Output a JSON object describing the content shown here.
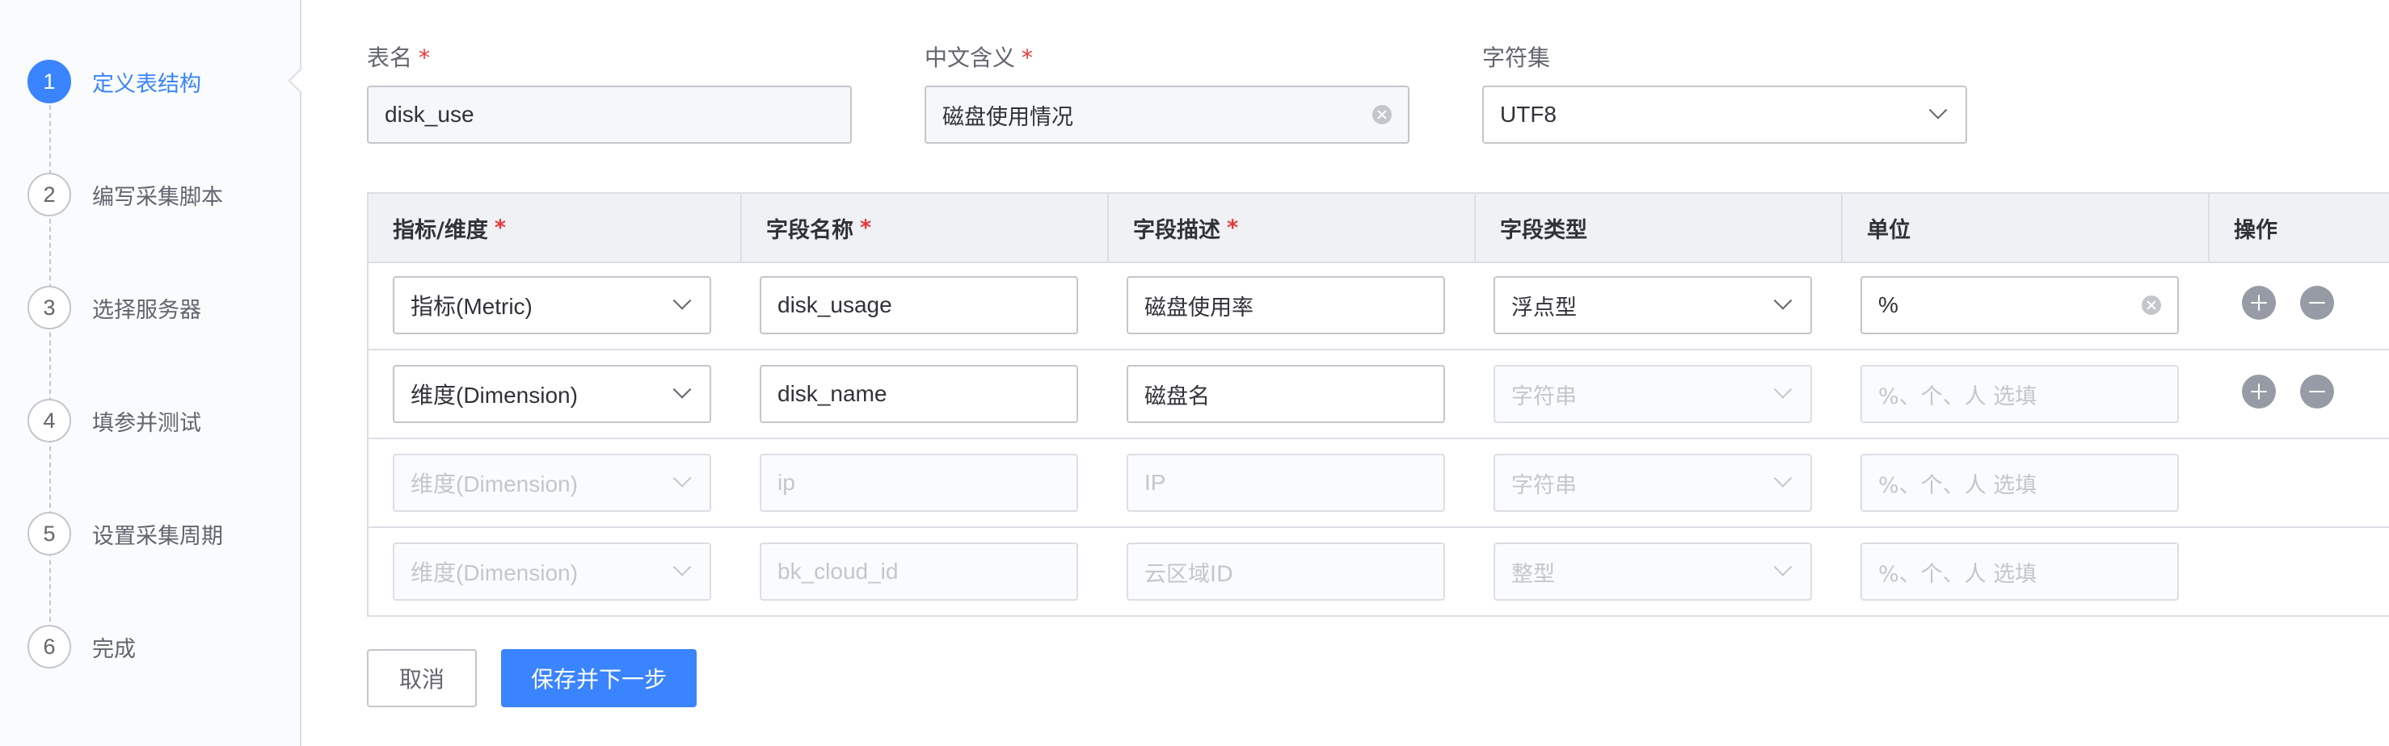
{
  "steps": [
    {
      "num": "1",
      "label": "定义表结构"
    },
    {
      "num": "2",
      "label": "编写采集脚本"
    },
    {
      "num": "3",
      "label": "选择服务器"
    },
    {
      "num": "4",
      "label": "填参并测试"
    },
    {
      "num": "5",
      "label": "设置采集周期"
    },
    {
      "num": "6",
      "label": "完成"
    }
  ],
  "active_step": "1",
  "form": {
    "table_name": {
      "label": "表名",
      "required": "*",
      "value": "disk_use"
    },
    "chinese_meaning": {
      "label": "中文含义",
      "required": "*",
      "value": "磁盘使用情况"
    },
    "charset": {
      "label": "字符集",
      "value": "UTF8"
    }
  },
  "table": {
    "headers": {
      "metric_dimension": "指标/维度",
      "field_name": "字段名称",
      "field_desc": "字段描述",
      "field_type": "字段类型",
      "unit": "单位",
      "operation": "操作"
    },
    "required_mark": "*",
    "unit_placeholder": "%、个、人 选填",
    "rows": [
      {
        "kind": "指标(Metric)",
        "name": "disk_usage",
        "desc": "磁盘使用率",
        "type": "浮点型",
        "unit": "%"
      },
      {
        "kind": "维度(Dimension)",
        "name": "disk_name",
        "desc": "磁盘名",
        "type": "字符串",
        "unit": ""
      },
      {
        "kind": "维度(Dimension)",
        "name": "ip",
        "desc": "IP",
        "type": "字符串",
        "unit": ""
      },
      {
        "kind": "维度(Dimension)",
        "name": "bk_cloud_id",
        "desc": "云区域ID",
        "type": "整型",
        "unit": ""
      }
    ]
  },
  "buttons": {
    "cancel": "取消",
    "save_next": "保存并下一步"
  },
  "colors": {
    "primary": "#3a84ff",
    "required": "#ea3636",
    "border": "#c4c6cc"
  }
}
